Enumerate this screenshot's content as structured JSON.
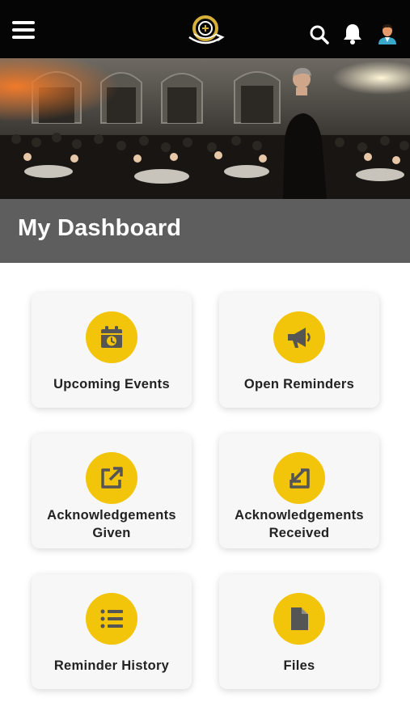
{
  "header": {
    "menu_icon": "hamburger-menu-icon",
    "logo_icon": "club-emblem-logo",
    "search_icon": "search-icon",
    "notification_icon": "bell-icon",
    "avatar_icon": "user-avatar"
  },
  "hero": {
    "image": "banquet-hall-photo"
  },
  "dashboard": {
    "title": "My Dashboard"
  },
  "tiles": [
    {
      "label": "Upcoming Events",
      "icon": "calendar-clock-icon"
    },
    {
      "label": "Open Reminders",
      "icon": "megaphone-icon"
    },
    {
      "label": "Acknowledgements Given",
      "icon": "external-arrow-out-icon"
    },
    {
      "label": "Acknowledgements Received",
      "icon": "arrow-in-icon"
    },
    {
      "label": "Reminder History",
      "icon": "list-icon"
    },
    {
      "label": "Files",
      "icon": "file-icon"
    }
  ],
  "colors": {
    "topbar": "#050505",
    "title_band": "#5e5e5e",
    "accent_yellow": "#f2c40a",
    "icon_gray": "#555555",
    "tile_bg": "#f7f7f7"
  }
}
